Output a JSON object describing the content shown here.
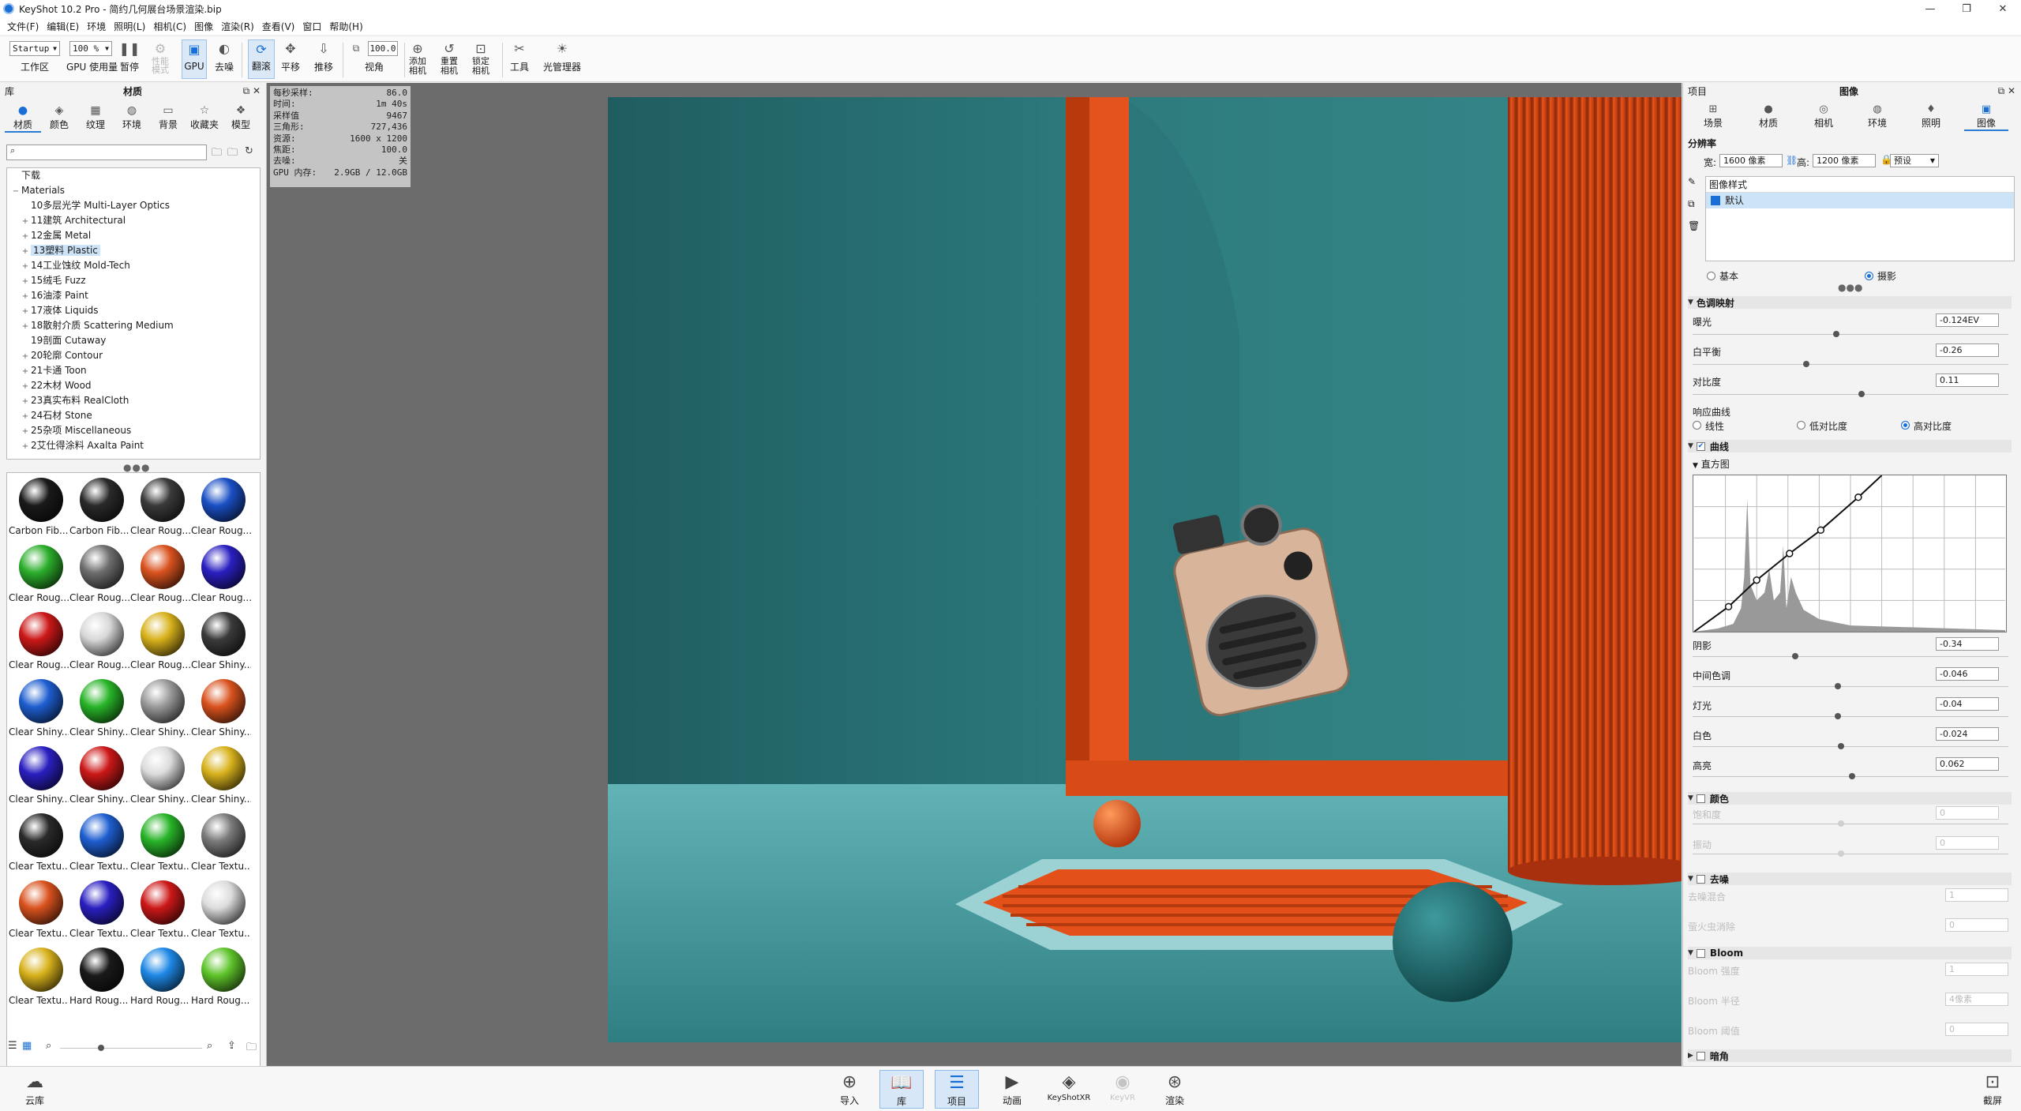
{
  "window": {
    "title": "KeyShot 10.2 Pro  - 简约几何展台场景渲染.bip",
    "controls": [
      "—",
      "❐",
      "✕"
    ]
  },
  "menu": [
    "文件(F)",
    "编辑(E)",
    "环境",
    "照明(L)",
    "相机(C)",
    "图像",
    "渲染(R)",
    "查看(V)",
    "窗口",
    "帮助(H)"
  ],
  "toolbar": {
    "workspace_value": "Startup",
    "workspace_label": "工作区",
    "zoom_value": "100 %",
    "gpu_usage_label": "GPU 使用量",
    "pause_label": "暂停",
    "perf_mode_label": "性能\n模式",
    "gpu_label": "GPU",
    "denoise_label": "去噪",
    "tumble_label": "翻滚",
    "pan_label": "平移",
    "dolly_label": "推移",
    "fov_value": "100.0",
    "fov_label": "视角",
    "add_camera_label": "添加\n相机",
    "reset_camera_label": "重置\n相机",
    "lock_camera_label": "锁定\n相机",
    "tools_label": "工具",
    "light_manager_label": "光管理器"
  },
  "library": {
    "panel_title": "库",
    "panel_center": "材质",
    "tabs": [
      "材质",
      "颜色",
      "纹理",
      "环境",
      "背景",
      "收藏夹",
      "模型"
    ],
    "tree": [
      {
        "label": "下载",
        "pm": "",
        "indent": 0
      },
      {
        "label": "Materials",
        "pm": "−",
        "indent": 0
      },
      {
        "label": "10多层光学 Multi-Layer Optics",
        "pm": "",
        "indent": 1
      },
      {
        "label": "11建筑 Architectural",
        "pm": "+",
        "indent": 1
      },
      {
        "label": "12金属 Metal",
        "pm": "+",
        "indent": 1
      },
      {
        "label": "13塑料 Plastic",
        "pm": "+",
        "indent": 1,
        "selected": true
      },
      {
        "label": "14工业蚀纹 Mold-Tech",
        "pm": "+",
        "indent": 1
      },
      {
        "label": "15绒毛 Fuzz",
        "pm": "+",
        "indent": 1
      },
      {
        "label": "16油漆 Paint",
        "pm": "+",
        "indent": 1
      },
      {
        "label": "17液体 Liquids",
        "pm": "+",
        "indent": 1
      },
      {
        "label": "18散射介质 Scattering Medium",
        "pm": "+",
        "indent": 1
      },
      {
        "label": "19剖面 Cutaway",
        "pm": "",
        "indent": 1
      },
      {
        "label": "20轮廓 Contour",
        "pm": "+",
        "indent": 1
      },
      {
        "label": "21卡通 Toon",
        "pm": "+",
        "indent": 1
      },
      {
        "label": "22木材 Wood",
        "pm": "+",
        "indent": 1
      },
      {
        "label": "23真实布料 RealCloth",
        "pm": "+",
        "indent": 1
      },
      {
        "label": "24石材 Stone",
        "pm": "+",
        "indent": 1
      },
      {
        "label": "25杂项 Miscellaneous",
        "pm": "+",
        "indent": 1
      },
      {
        "label": "2艾仕得涂料 Axalta Paint",
        "pm": "+",
        "indent": 1
      }
    ],
    "thumbnails": [
      {
        "label": "Carbon Fib...",
        "color": "#1a1a1a"
      },
      {
        "label": "Carbon Fib...",
        "color": "#2a2a2a"
      },
      {
        "label": "Clear Roug...",
        "color": "#3a3a3a"
      },
      {
        "label": "Clear Roug...",
        "color": "#1a4fc4"
      },
      {
        "label": "Clear Roug...",
        "color": "#2cae2c"
      },
      {
        "label": "Clear Roug...",
        "color": "#6e6e6e"
      },
      {
        "label": "Clear Roug...",
        "color": "#d9521e"
      },
      {
        "label": "Clear Roug...",
        "color": "#2a1fc0"
      },
      {
        "label": "Clear Roug...",
        "color": "#cc1818"
      },
      {
        "label": "Clear Roug...",
        "color": "#d8d8d8"
      },
      {
        "label": "Clear Roug...",
        "color": "#d8b21c"
      },
      {
        "label": "Clear Shiny...",
        "color": "#3a3a3a"
      },
      {
        "label": "Clear Shiny...",
        "color": "#1e5ed0"
      },
      {
        "label": "Clear Shiny...",
        "color": "#28b428"
      },
      {
        "label": "Clear Shiny...",
        "color": "#9a9a9a"
      },
      {
        "label": "Clear Shiny...",
        "color": "#d9521e"
      },
      {
        "label": "Clear Shiny...",
        "color": "#2a1fc0"
      },
      {
        "label": "Clear Shiny...",
        "color": "#cc1818"
      },
      {
        "label": "Clear Shiny...",
        "color": "#dcdcdc"
      },
      {
        "label": "Clear Shiny...",
        "color": "#d8b21c"
      },
      {
        "label": "Clear Textu...",
        "color": "#2a2a2a"
      },
      {
        "label": "Clear Textu...",
        "color": "#1e5ed0"
      },
      {
        "label": "Clear Textu...",
        "color": "#28b428"
      },
      {
        "label": "Clear Textu...",
        "color": "#7a7a7a"
      },
      {
        "label": "Clear Textu...",
        "color": "#d9521e"
      },
      {
        "label": "Clear Textu...",
        "color": "#2a1fc0"
      },
      {
        "label": "Clear Textu...",
        "color": "#cc1818"
      },
      {
        "label": "Clear Textu...",
        "color": "#dcdcdc"
      },
      {
        "label": "Clear Textu...",
        "color": "#d8b21c"
      },
      {
        "label": "Hard Roug...",
        "color": "#1a1a1a"
      },
      {
        "label": "Hard Roug...",
        "color": "#1e88e5"
      },
      {
        "label": "Hard Roug...",
        "color": "#5ec42a"
      }
    ]
  },
  "hud": [
    {
      "k": "每秒采样:",
      "v": "86.0"
    },
    {
      "k": "时间:",
      "v": "1m 40s"
    },
    {
      "k": "采样值",
      "v": "9467"
    },
    {
      "k": "三角形:",
      "v": "727,436"
    },
    {
      "k": "资源:",
      "v": "1600 x 1200"
    },
    {
      "k": "焦距:",
      "v": "100.0"
    },
    {
      "k": "去噪:",
      "v": "关"
    },
    {
      "k": "GPU 内存:",
      "v": "2.9GB / 12.0GB"
    }
  ],
  "project": {
    "panel_title": "项目",
    "panel_center": "图像",
    "tabs": [
      "场景",
      "材质",
      "相机",
      "环境",
      "照明",
      "图像"
    ],
    "resolution_label": "分辨率",
    "width_label": "宽:",
    "width_value": "1600 像素",
    "height_label": "高:",
    "height_value": "1200 像素",
    "preset_label": "预设",
    "style_header": "图像样式",
    "style_default": "默认",
    "mode_basic": "基本",
    "mode_photo": "摄影",
    "tonemap_section": "色调映射",
    "exposure_label": "曝光",
    "exposure_value": "-0.124EV",
    "white_balance_label": "白平衡",
    "white_balance_value": "-0.26",
    "contrast_label": "对比度",
    "contrast_value": "0.11",
    "response_curve_label": "响应曲线",
    "curve_linear": "线性",
    "curve_low": "低对比度",
    "curve_high": "高对比度",
    "curves_section": "曲线",
    "histogram_label": "直方图",
    "shadows_label": "阴影",
    "shadows_value": "-0.34",
    "midtones_label": "中间色调",
    "midtones_value": "-0.046",
    "highlights_label": "灯光",
    "highlights_value": "-0.04",
    "whites_label": "白色",
    "whites_value": "-0.024",
    "brights_label": "高亮",
    "brights_value": "0.062",
    "color_section": "颜色",
    "saturation_label": "饱和度",
    "saturation_value": "0",
    "vibrance_label": "振动",
    "vibrance_value": "0",
    "denoise_section": "去噪",
    "denoise_blend_label": "去噪混合",
    "denoise_blend_value": "1",
    "firefly_label": "萤火虫消除",
    "firefly_value": "0",
    "bloom_section": "Bloom",
    "bloom_strength_label": "Bloom 强度",
    "bloom_strength_value": "1",
    "bloom_radius_label": "Bloom 半径",
    "bloom_radius_value": "4像素",
    "bloom_threshold_label": "Bloom 阈值",
    "bloom_threshold_value": "0",
    "vignette_section": "暗角"
  },
  "bottom": {
    "cloud_label": "云库",
    "items": [
      "导入",
      "库",
      "项目",
      "动画",
      "KeyShotXR",
      "KeyVR",
      "渲染"
    ],
    "screenshot_label": "截屏"
  }
}
